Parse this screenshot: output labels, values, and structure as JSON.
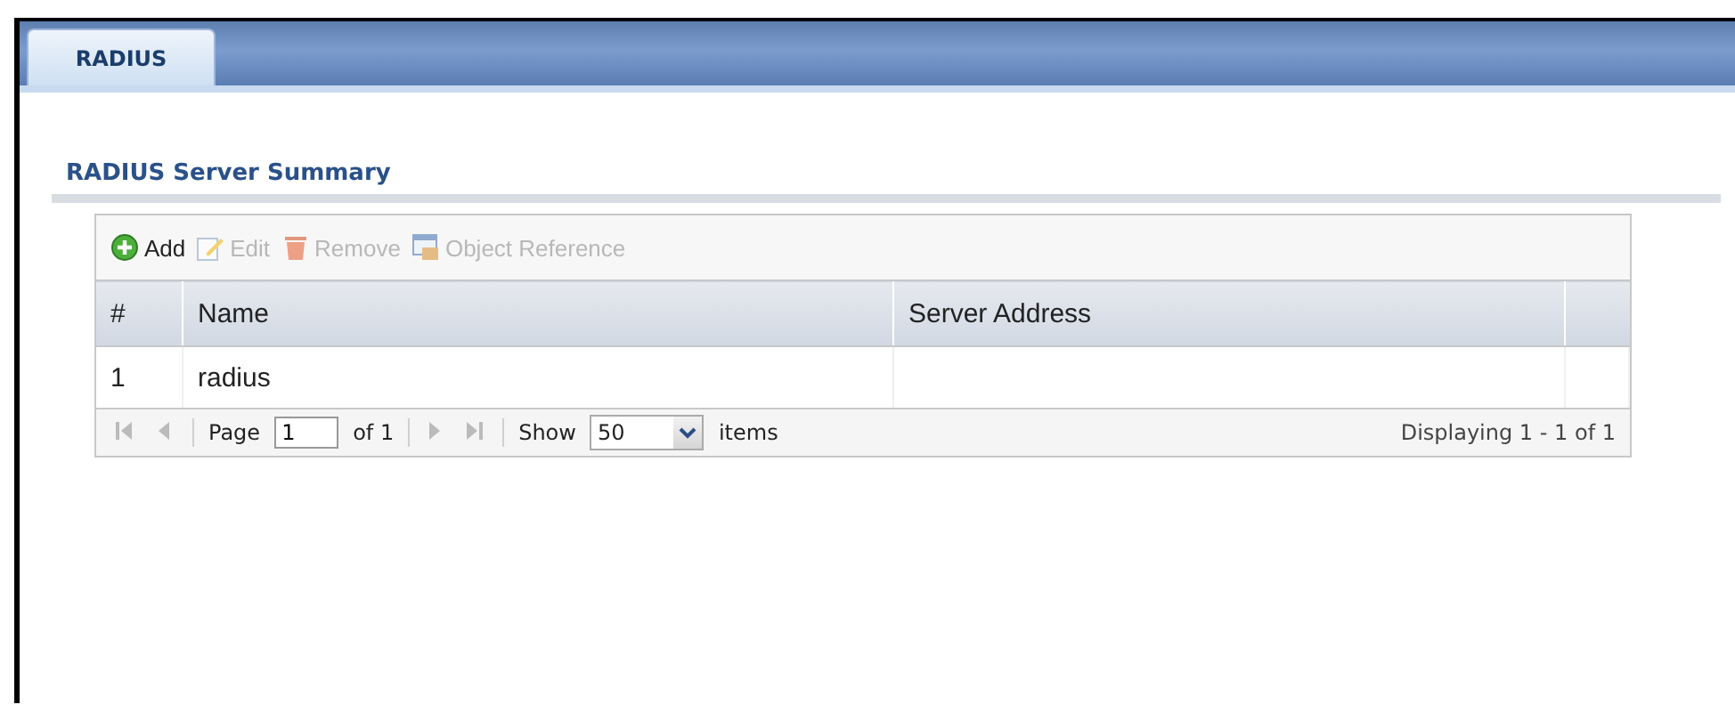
{
  "tabs": [
    {
      "label": "RADIUS",
      "selected": true
    }
  ],
  "section": {
    "title": "RADIUS Server Summary"
  },
  "toolbar": [
    {
      "kind": "add",
      "label": "Add",
      "disabled": false
    },
    {
      "kind": "edit",
      "label": "Edit",
      "disabled": true
    },
    {
      "kind": "remove",
      "label": "Remove",
      "disabled": true
    },
    {
      "kind": "reference",
      "label": "Object Reference",
      "disabled": true
    }
  ],
  "table": {
    "columns": [
      "#",
      "Name",
      "Server Address"
    ],
    "rows": [
      [
        "1",
        "radius",
        ""
      ]
    ]
  },
  "pager": {
    "first_disabled": true,
    "prev_disabled": true,
    "next_disabled": true,
    "last_disabled": true,
    "page_label": "Page",
    "page": "1",
    "of": "of 1",
    "show_label": "Show",
    "show": "50",
    "items_label": "items",
    "displaying": "Displaying 1 - 1 of 1"
  }
}
